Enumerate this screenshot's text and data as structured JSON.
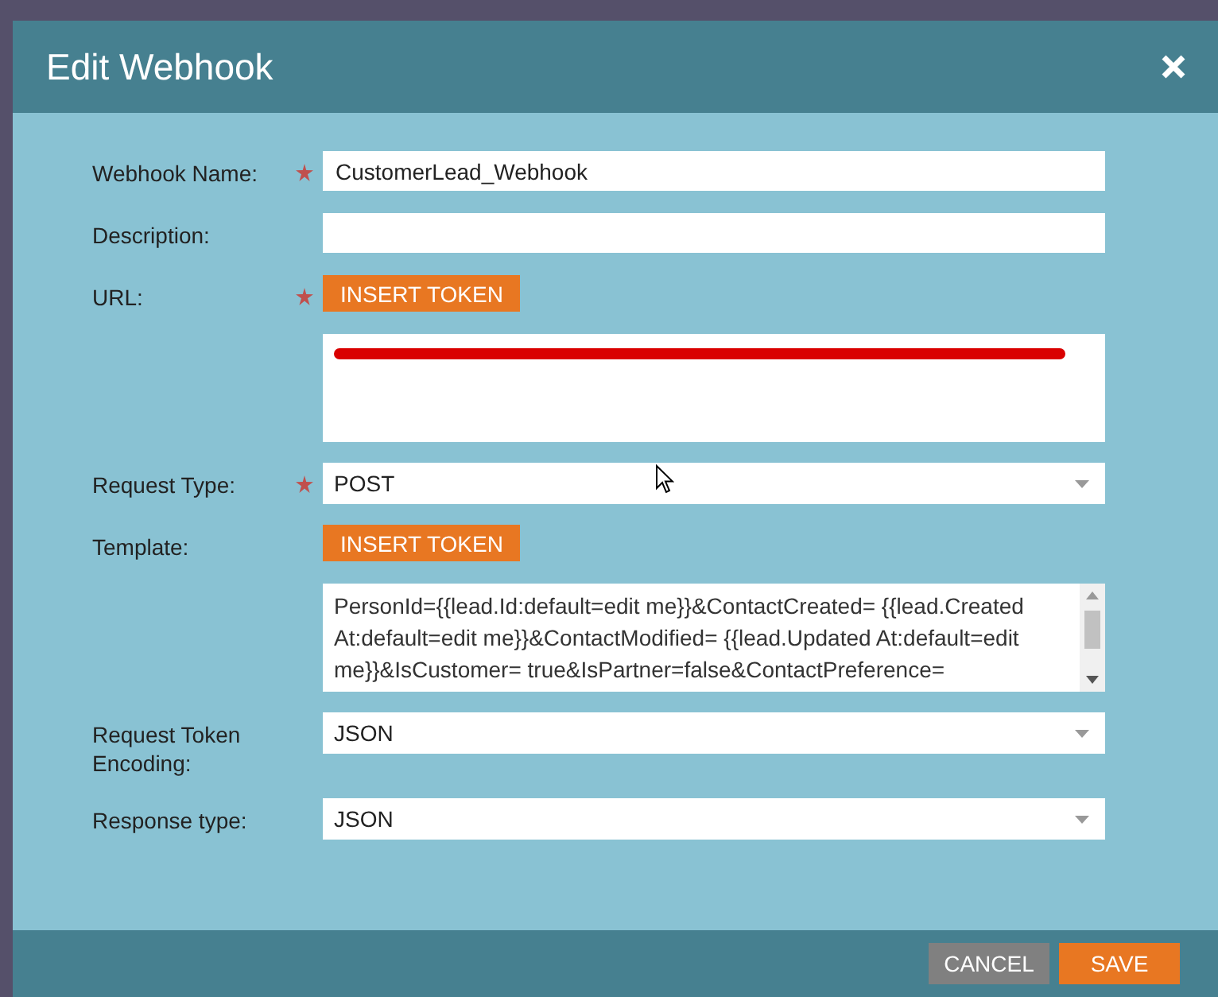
{
  "dialog": {
    "title": "Edit Webhook"
  },
  "fields": [
    {
      "kind": "text",
      "label": "Webhook Name:",
      "required": true,
      "value": "CustomerLead_Webhook"
    },
    {
      "kind": "text",
      "label": "Description:",
      "required": false
    },
    {
      "kind": "token_area",
      "label": "URL:",
      "required": true,
      "button": "INSERT TOKEN",
      "redacted": true
    },
    {
      "kind": "select",
      "label": "Request Type:",
      "required": true,
      "value": "POST"
    },
    {
      "kind": "token_area",
      "label": "Template:",
      "required": false,
      "button": "INSERT TOKEN",
      "value": "PersonId={{lead.Id:default=edit me}}&ContactCreated= {{lead.Created At:default=edit me}}&ContactModified= {{lead.Updated At:default=edit me}}&IsCustomer= true&IsPartner=false&ContactPreference="
    },
    {
      "kind": "select",
      "label": "Request Token Encoding:",
      "required": false,
      "value": "JSON"
    },
    {
      "kind": "select",
      "label": "Response type:",
      "required": false,
      "value": "JSON"
    }
  ],
  "buttons": [
    {
      "label": "CANCEL",
      "kind": "secondary"
    },
    {
      "label": "SAVE",
      "kind": "primary"
    }
  ]
}
